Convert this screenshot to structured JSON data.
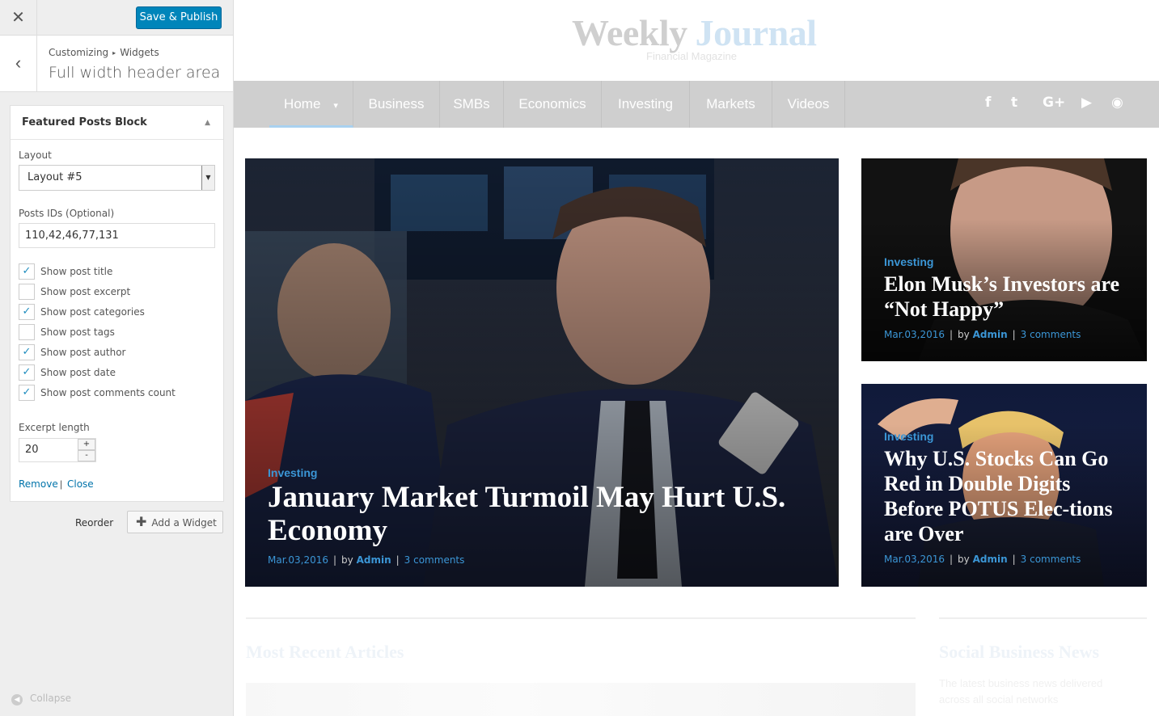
{
  "customizer": {
    "close_glyph": "✕",
    "save_label": "Save & Publish",
    "back_glyph": "‹",
    "breadcrumb": [
      "Customizing",
      "Widgets"
    ],
    "breadcrumb_sep": "▸",
    "section_title": "Full width header area",
    "widget": {
      "title": "Featured Posts Block",
      "arrow": "▲",
      "layout_label": "Layout",
      "layout_value": "Layout #5",
      "posts_label": "Posts IDs (Optional)",
      "posts_value": "110,42,46,77,131",
      "checkboxes": [
        {
          "label": "Show post title",
          "checked": true
        },
        {
          "label": "Show post excerpt",
          "checked": false
        },
        {
          "label": "Show post categories",
          "checked": true
        },
        {
          "label": "Show post tags",
          "checked": false
        },
        {
          "label": "Show post author",
          "checked": true
        },
        {
          "label": "Show post date",
          "checked": true
        },
        {
          "label": "Show post comments count",
          "checked": true
        }
      ],
      "excerpt_label": "Excerpt length",
      "excerpt_value": "20",
      "remove_label": "Remove",
      "close_label": "Close"
    },
    "reorder_label": "Reorder",
    "add_widget_label": "Add a Widget",
    "collapse_label": "Collapse"
  },
  "preview": {
    "logo_part1": "Weekly",
    "logo_part2": "Journal",
    "tagline": "Financial Magazine",
    "nav": [
      "Home",
      "Business",
      "SMBs",
      "Economics",
      "Investing",
      "Markets",
      "Videos"
    ],
    "social_icons": [
      "facebook-icon",
      "twitter-icon",
      "google-plus-icon",
      "youtube-icon",
      "rss-icon"
    ],
    "social_glyphs": [
      "f",
      "t",
      "G+",
      "▶",
      "◉"
    ],
    "posts": [
      {
        "category": "Investing",
        "title": "January Market Turmoil May Hurt U.S. Economy",
        "date": "Mar.03,2016",
        "by": "by",
        "author": "Admin",
        "comments": "3 comments"
      },
      {
        "category": "Investing",
        "title": "Elon Musk’s Investors are “Not Happy”",
        "date": "Mar.03,2016",
        "by": "by",
        "author": "Admin",
        "comments": "3 comments"
      },
      {
        "category": "Investing",
        "title": "Why U.S. Stocks Can Go Red in Double Digits Before POTUS Elec-tions are Over",
        "date": "Mar.03,2016",
        "by": "by",
        "author": "Admin",
        "comments": "3 comments"
      }
    ],
    "section_recent": "Most Recent Articles",
    "section_social": "Social Business News",
    "social_text": "The latest business news delivered across all social networks"
  }
}
